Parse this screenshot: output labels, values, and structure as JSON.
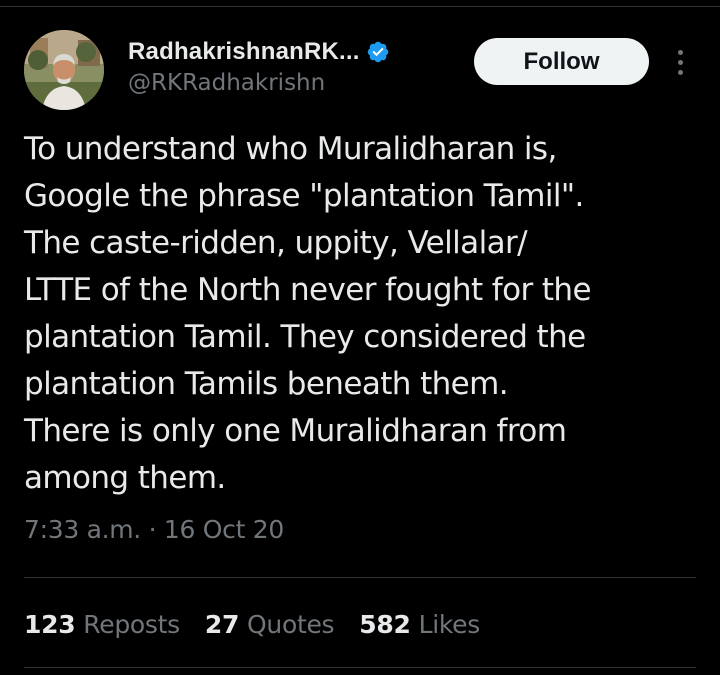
{
  "author": {
    "display_name": "RadhakrishnanRK...",
    "handle": "@RKRadhakrishn",
    "verified_icon": "verified-badge-icon",
    "avatar_icon": "profile-photo"
  },
  "actions": {
    "follow_label": "Follow",
    "more_icon": "more-options-icon"
  },
  "tweet": {
    "lines": [
      "To understand who Muralidharan is,",
      "Google the phrase \"plantation Tamil\".",
      "The caste-ridden, uppity, Vellalar/",
      "LTTE of the North never fought for the",
      "plantation Tamil. They considered the",
      "plantation Tamils beneath them.",
      "There is only one Muralidharan from",
      "among them."
    ],
    "timestamp": "7:33 a.m. · 16 Oct 20"
  },
  "stats": [
    {
      "count": "123",
      "label": "Reposts"
    },
    {
      "count": "27",
      "label": "Quotes"
    },
    {
      "count": "582",
      "label": "Likes"
    }
  ],
  "colors": {
    "background": "#000000",
    "text": "#e7e9ea",
    "muted": "#71767b",
    "verified": "#1d9bf0",
    "follow_bg": "#eff3f4",
    "divider": "#2f3336"
  }
}
